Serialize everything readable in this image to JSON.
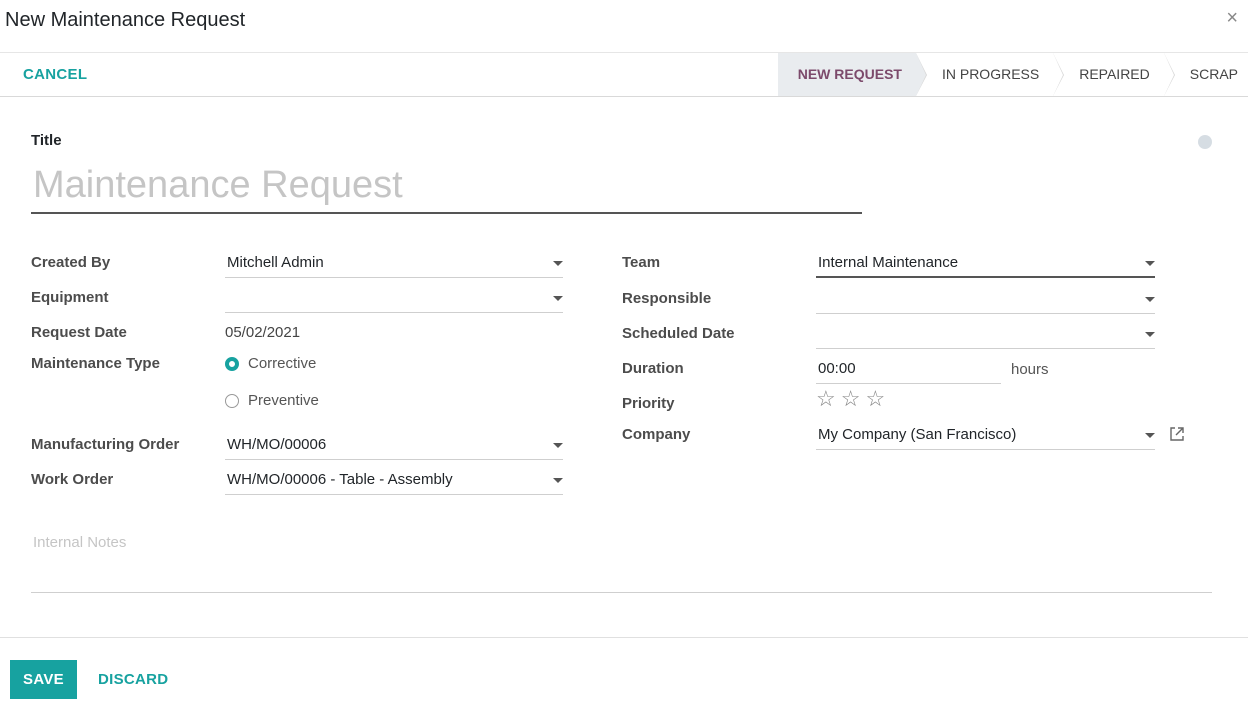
{
  "dialog": {
    "title": "New Maintenance Request",
    "close_symbol": "×"
  },
  "statusbar": {
    "cancel_label": "CANCEL",
    "stages": [
      {
        "label": "NEW REQUEST",
        "active": true
      },
      {
        "label": "IN PROGRESS",
        "active": false
      },
      {
        "label": "REPAIRED",
        "active": false
      },
      {
        "label": "SCRAP",
        "active": false
      }
    ]
  },
  "form": {
    "title_label": "Title",
    "title_placeholder": "Maintenance Request",
    "left": {
      "created_by": {
        "label": "Created By",
        "value": "Mitchell Admin"
      },
      "equipment": {
        "label": "Equipment",
        "value": ""
      },
      "request_date": {
        "label": "Request Date",
        "value": "05/02/2021"
      },
      "maintenance_type": {
        "label": "Maintenance Type",
        "options": [
          {
            "label": "Corrective",
            "selected": true
          },
          {
            "label": "Preventive",
            "selected": false
          }
        ]
      },
      "manufacturing_order": {
        "label": "Manufacturing Order",
        "value": "WH/MO/00006"
      },
      "work_order": {
        "label": "Work Order",
        "value": "WH/MO/00006 - Table - Assembly"
      }
    },
    "right": {
      "team": {
        "label": "Team",
        "value": "Internal Maintenance"
      },
      "responsible": {
        "label": "Responsible",
        "value": ""
      },
      "scheduled_date": {
        "label": "Scheduled Date",
        "value": ""
      },
      "duration": {
        "label": "Duration",
        "value": "00:00",
        "unit": "hours"
      },
      "priority": {
        "label": "Priority",
        "stars": 3,
        "filled": 0
      },
      "company": {
        "label": "Company",
        "value": "My Company (San Francisco)"
      }
    },
    "notes_placeholder": "Internal Notes"
  },
  "footer": {
    "save_label": "SAVE",
    "discard_label": "DISCARD"
  },
  "icons": {
    "star": "☆",
    "external_link": "external-link-icon",
    "kanban_state": "status-dot-icon"
  },
  "colors": {
    "accent": "#17a2a0",
    "active_stage_text": "#7c4a6b",
    "active_stage_bg": "#e9ecef"
  }
}
